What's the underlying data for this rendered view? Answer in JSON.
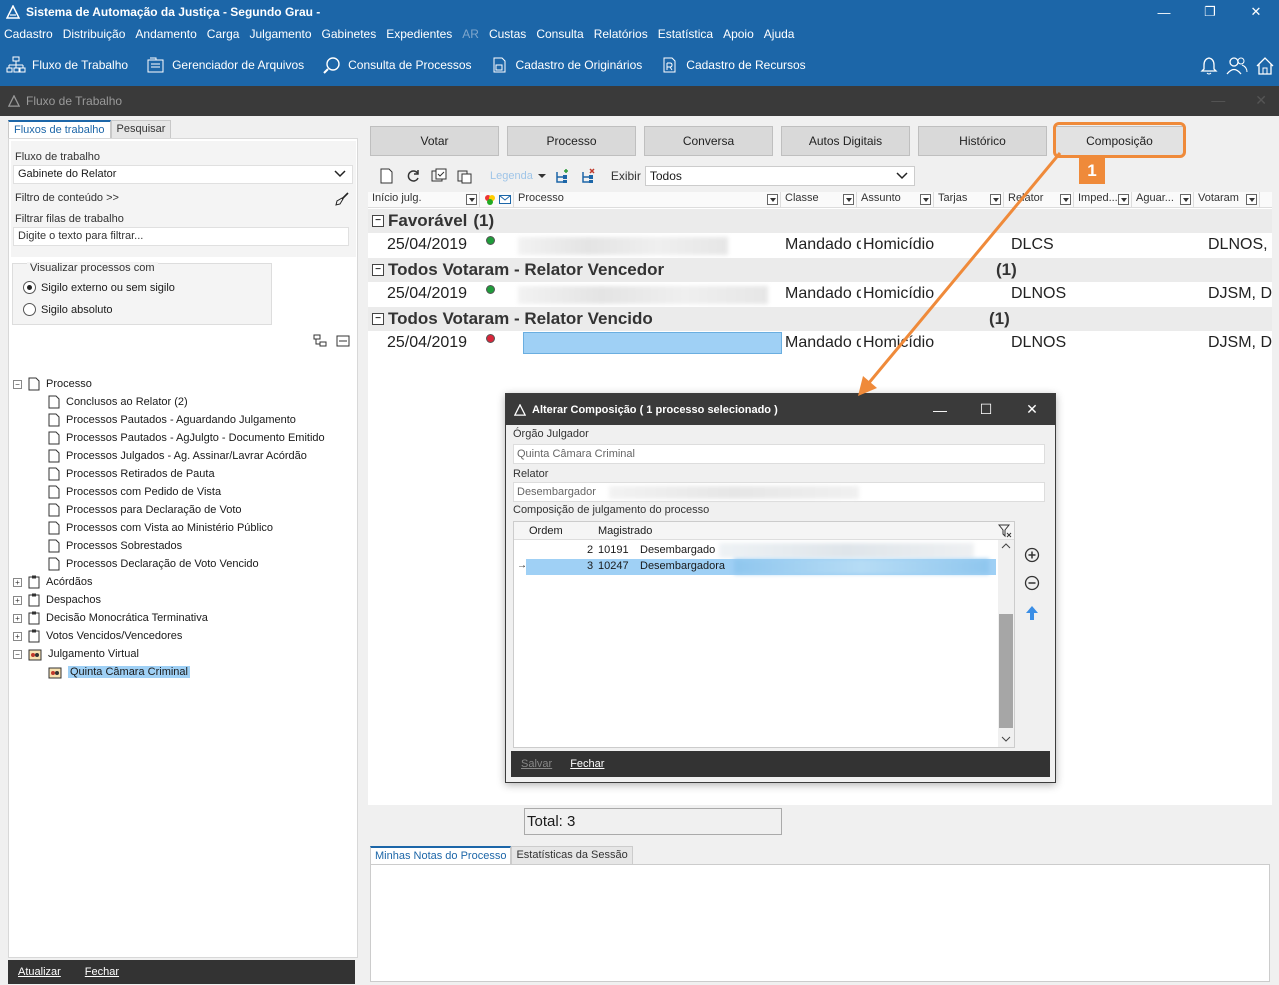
{
  "window": {
    "title": "Sistema de Automação da Justiça - Segundo Grau -",
    "minimize": "—",
    "restore": "❐",
    "close": "✕"
  },
  "menu": [
    "Cadastro",
    "Distribuição",
    "Andamento",
    "Carga",
    "Julgamento",
    "Gabinetes",
    "Expedientes",
    "AR",
    "Custas",
    "Consulta",
    "Relatórios",
    "Estatística",
    "Apoio",
    "Ajuda"
  ],
  "menu_disabled": [
    "AR"
  ],
  "toolbar": {
    "fluxo": "Fluxo de Trabalho",
    "gerenciador": "Gerenciador de Arquivos",
    "consulta": "Consulta de Processos",
    "originarios": "Cadastro de Originários",
    "recursos": "Cadastro de Recursos"
  },
  "subwindow": {
    "title": "Fluxo de Trabalho",
    "minimize": "—",
    "close": "✕"
  },
  "left": {
    "tabs": [
      "Fluxos de trabalho",
      "Pesquisar"
    ],
    "fluxo_label": "Fluxo de trabalho",
    "fluxo_value": "Gabinete do Relator",
    "filtro_conteudo": "Filtro de conteúdo >>",
    "filtrar_label": "Filtrar filas de trabalho",
    "filtrar_placeholder": "Digite o texto para filtrar...",
    "visualizar_label": "Visualizar processos com",
    "radio1": "Sigilo externo ou sem sigilo",
    "radio2": "Sigilo absoluto",
    "tree": {
      "processo": "Processo",
      "children": [
        "Conclusos ao Relator (2)",
        "Processos Pautados - Aguardando Julgamento",
        "Processos Pautados - AgJulgto - Documento Emitido",
        "Processos Julgados - Ag. Assinar/Lavrar Acórdão",
        "Processos Retirados de Pauta",
        "Processos com Pedido de Vista",
        "Processos para Declaração de Voto",
        "Processos com Vista ao Ministério Público",
        "Processos Sobrestados",
        "Processos Declaração de Voto Vencido"
      ],
      "acordaos": "Acórdãos",
      "despachos": "Despachos",
      "decisao": "Decisão Monocrática Terminativa",
      "votos": "Votos Vencidos/Vencedores",
      "julgamento_virtual": "Julgamento Virtual",
      "quinta": "Quinta Câmara Criminal"
    },
    "footer": {
      "atualizar": "Atualizar",
      "fechar": "Fechar"
    }
  },
  "right": {
    "tabs": [
      "Votar",
      "Processo",
      "Conversa",
      "Autos Digitais",
      "Histórico",
      "Composição"
    ],
    "legenda": "Legenda",
    "exibir_label": "Exibir",
    "exibir_value": "Todos",
    "columns": [
      "Início julg.",
      "",
      "Processo",
      "Classe",
      "Assunto",
      "Tarjas",
      "Relator",
      "Imped...",
      "Aguar...",
      "Votaram"
    ],
    "groups": [
      {
        "title": "Favorável",
        "count": "(1)",
        "row": {
          "inicio": "25/04/2019",
          "status": "green",
          "classe": "Mandado de Segurança",
          "assunto": "Homicídio",
          "relator": "DLCS",
          "votaram": "DLNOS, DJSM"
        }
      },
      {
        "title": "Todos Votaram - Relator Vencedor",
        "count": "(1)",
        "row": {
          "inicio": "25/04/2019",
          "status": "green",
          "classe": "Mandado de Segurança",
          "assunto": "Homicídio",
          "relator": "DLNOS",
          "votaram": "DJSM, DCLS"
        }
      },
      {
        "title": "Todos Votaram - Relator Vencido",
        "count": "(1)",
        "row": {
          "inicio": "25/04/2019",
          "status": "red",
          "classe": "Mandado de Segurança",
          "assunto": "Homicídio",
          "relator": "DLNOS",
          "votaram": "DJSM, DCLS"
        }
      }
    ],
    "total": "Total: 3",
    "bottom_tabs": [
      "Minhas Notas do Processo",
      "Estatísticas da Sessão"
    ]
  },
  "dialog": {
    "title": "Alterar Composição ( 1 processo selecionado )",
    "minimize": "—",
    "maximize": "☐",
    "close": "✕",
    "orgao_label": "Órgão Julgador",
    "orgao_value": "Quinta Câmara Criminal",
    "relator_label": "Relator",
    "relator_value": "Desembargador",
    "composicao_label": "Composição de julgamento do processo",
    "col_ordem": "Ordem",
    "col_magistrado": "Magistrado",
    "rows": [
      {
        "ordem": "2",
        "codigo": "10191",
        "nome": "Desembargado"
      },
      {
        "ordem": "3",
        "codigo": "10247",
        "nome": "Desembargadora"
      }
    ],
    "footer": {
      "salvar": "Salvar",
      "fechar": "Fechar"
    }
  },
  "annotation": {
    "badge": "1",
    "color": "#ef8a3a"
  },
  "colors": {
    "brand": "#1c66a8",
    "selection": "#9fd0f5",
    "dark": "#3a3a3a"
  }
}
